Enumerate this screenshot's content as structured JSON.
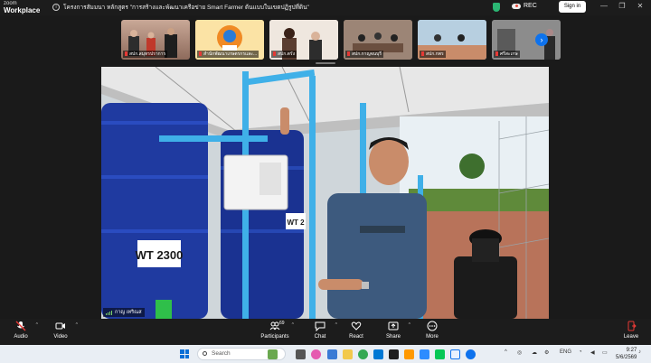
{
  "window": {
    "brand_top": "zoom",
    "brand_bottom": "Workplace",
    "title": "โครงการสัมมนา หลักสูตร \"การสร้างและพัฒนาเครือข่าย Smart Farmer ต้นแบบในเขตปฏิรูปที่ดิน\"",
    "rec_label": "REC",
    "sign_in_label": "Sign in"
  },
  "thumbnails": [
    {
      "label": "สปก.สมุทรปราการ",
      "bg": "#b58f7a"
    },
    {
      "label": "สำนักพัฒนาเกษตรกรและ...",
      "bg": "#f4b223"
    },
    {
      "label": "สปก.ตรัง",
      "bg": "#d9c9bf"
    },
    {
      "label": "สปก.กาญจนบุรี",
      "bg": "#8a7568"
    },
    {
      "label": "สปก.กพร",
      "bg": "#7fa9c9"
    },
    {
      "label": "ศรีสะเกษ",
      "bg": "#6b6b6b"
    }
  ],
  "video": {
    "speaker_name": "กาญ เทริณส",
    "tank_label": "WT 2300",
    "tank_label_small": "WT 2"
  },
  "toolbar": {
    "audio": "Audio",
    "video": "Video",
    "participants": "Participants",
    "participants_count": "69",
    "chat": "Chat",
    "react": "React",
    "share": "Share",
    "more": "More",
    "leave": "Leave"
  },
  "taskbar": {
    "search_placeholder": "Search",
    "language": "ENG",
    "time": "9:27",
    "date": "5/6/2569"
  },
  "colors": {
    "accent": "#0e72ed",
    "leave_red": "#e53935",
    "tank_blue": "#1f3aa0"
  }
}
